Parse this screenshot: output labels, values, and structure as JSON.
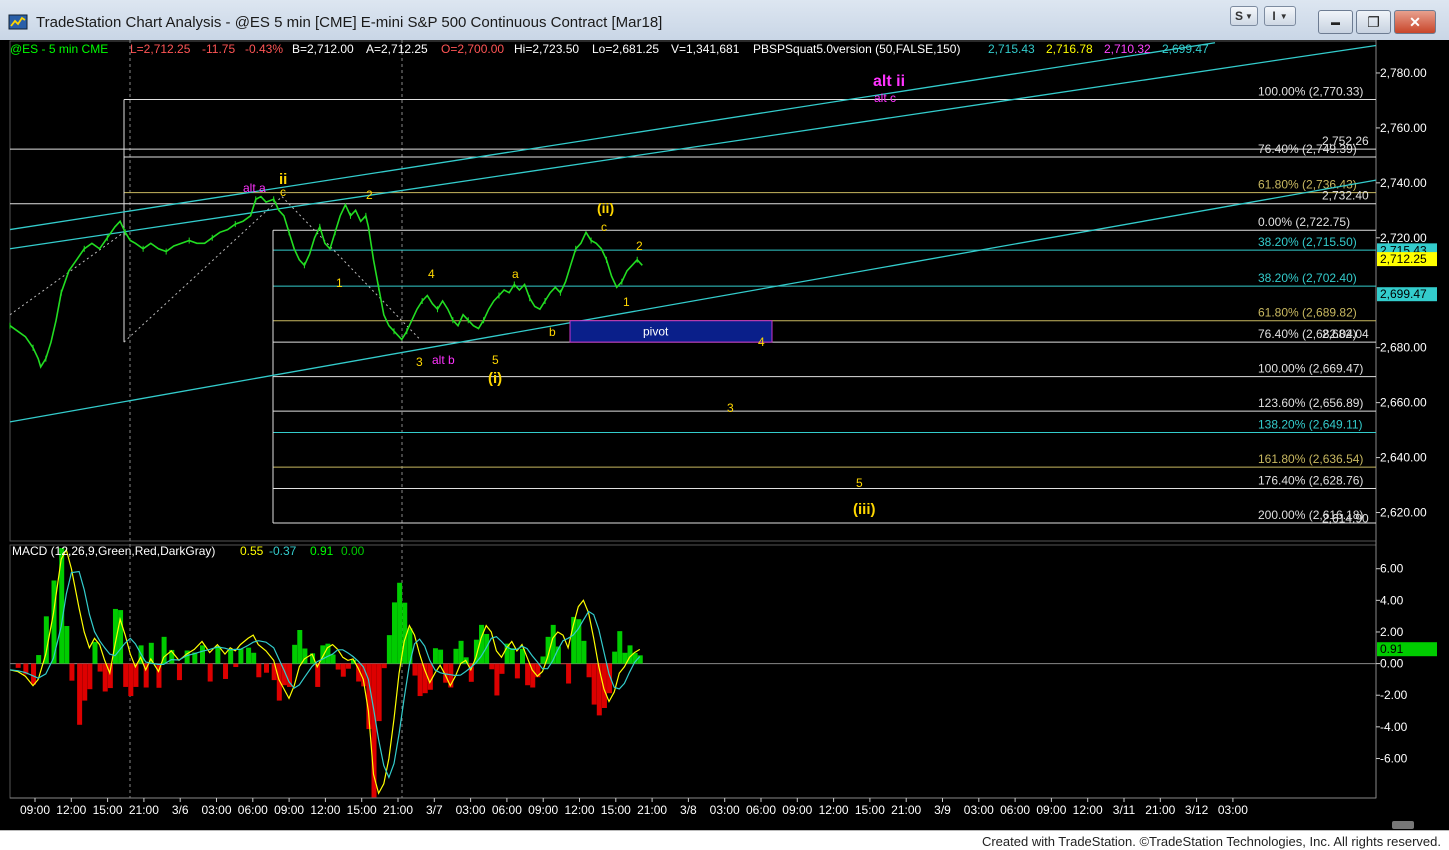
{
  "window": {
    "title": "TradeStation Chart Analysis - @ES 5 min [CME] E-mini S&P 500 Continuous Contract [Mar18]",
    "s_button": "S",
    "i_button": "I",
    "minimize": "▬",
    "maximize": "❐",
    "close": "✕"
  },
  "footer": {
    "text": "Created with TradeStation. ©TradeStation Technologies, Inc. All rights reserved."
  },
  "colors": {
    "price": "#22dd22",
    "cyan": "#33cccc",
    "yellow": "#ffd700",
    "magenta": "#ff33ff",
    "macd_up": "#00cc00",
    "macd_down": "#dd0000"
  },
  "chart_data": {
    "type": "line",
    "symbol": "@ES",
    "interval": "5 min",
    "exchange": "CME",
    "ylim": [
      2610,
      2792
    ],
    "status_bar": {
      "symbol_label": "@ES - 5 min  CME",
      "last": "L=2,712.25",
      "change": "-11.75",
      "change_pct": "-0.43%",
      "bid": "B=2,712.00",
      "ask": "A=2,712.25",
      "open": "O=2,700.00",
      "high": "Hi=2,723.50",
      "low": "Lo=2,681.25",
      "volume": "V=1,341,681",
      "indicator": "PBSPSquat5.0version (50,FALSE,150)",
      "ind_values": [
        "2,715.43",
        "2,716.78",
        "2,710.32",
        "2,699.47"
      ]
    },
    "y_ticks": [
      {
        "v": 2780,
        "label": "2,780.00"
      },
      {
        "v": 2760,
        "label": "2,760.00"
      },
      {
        "v": 2740,
        "label": "2,740.00"
      },
      {
        "v": 2720,
        "label": "2,720.00"
      },
      {
        "v": 2680,
        "label": "2,680.00"
      },
      {
        "v": 2660,
        "label": "2,660.00"
      },
      {
        "v": 2640,
        "label": "2,640.00"
      },
      {
        "v": 2620,
        "label": "2,620.00"
      }
    ],
    "price_tags": [
      {
        "v": 2715.43,
        "label": "2,715.43",
        "color": "#33cccc"
      },
      {
        "v": 2712.25,
        "label": "2,712.25",
        "color": "#ffff00"
      },
      {
        "v": 2699.47,
        "label": "2,699.47",
        "color": "#33cccc"
      }
    ],
    "x_ticks": [
      "09:00",
      "12:00",
      "15:00",
      "21:00",
      "3/6",
      "03:00",
      "06:00",
      "09:00",
      "12:00",
      "15:00",
      "21:00",
      "3/7",
      "03:00",
      "06:00",
      "09:00",
      "12:00",
      "15:00",
      "21:00",
      "3/8",
      "03:00",
      "06:00",
      "09:00",
      "12:00",
      "15:00",
      "21:00",
      "3/9",
      "03:00",
      "06:00",
      "09:00",
      "12:00",
      "3/11",
      "21:00",
      "3/12",
      "03:00"
    ],
    "fib_levels": [
      {
        "pct": "100.00%",
        "price": "(2,770.33)",
        "v": 2770.33,
        "color": "#e0e0e0"
      },
      {
        "pct": "76.40%",
        "price": "(2,749.39)",
        "v": 2749.39,
        "color": "#e0e0e0"
      },
      {
        "pct": "61.80%",
        "price": "(2,736.43)",
        "v": 2736.43,
        "color": "#c8b860"
      },
      {
        "pct": "0.00%",
        "price": "(2,722.75)",
        "v": 2722.75,
        "color": "#e0e0e0"
      },
      {
        "pct": "38.20%",
        "price": "(2,715.50)",
        "v": 2715.5,
        "color": "#33cccc"
      },
      {
        "pct": "38.20%",
        "price": "(2,702.40)",
        "v": 2702.4,
        "color": "#33cccc"
      },
      {
        "pct": "61.80%",
        "price": "(2,689.82)",
        "v": 2689.82,
        "color": "#c8b860"
      },
      {
        "pct": "76.40%",
        "price": "(2,682.04)",
        "v": 2682.04,
        "color": "#e0e0e0"
      },
      {
        "pct": "100.00%",
        "price": "(2,669.47)",
        "v": 2669.47,
        "color": "#e0e0e0"
      },
      {
        "pct": "123.60%",
        "price": "(2,656.89)",
        "v": 2656.89,
        "color": "#e0e0e0"
      },
      {
        "pct": "138.20%",
        "price": "(2,649.11)",
        "v": 2649.11,
        "color": "#33cccc"
      },
      {
        "pct": "161.80%",
        "price": "(2,636.54)",
        "v": 2636.54,
        "color": "#c8b860"
      },
      {
        "pct": "176.40%",
        "price": "(2,628.76)",
        "v": 2628.76,
        "color": "#e0e0e0"
      },
      {
        "pct": "200.00%",
        "price": "(2,616.18)",
        "v": 2616.18,
        "color": "#e0e0e0"
      }
    ],
    "extra_price_labels": [
      {
        "label": "2,752.26",
        "v": 2752.26
      },
      {
        "label": "2,732.40",
        "v": 2732.4
      },
      {
        "label": "2,682.04",
        "v": 2682.04
      },
      {
        "label": "2,614.90",
        "v": 2614.9
      }
    ],
    "pivot_label": "pivot",
    "pivot_range": [
      2682.04,
      2689.82
    ],
    "wave_labels": [
      {
        "text": "alt ii",
        "color": "#ff33ff",
        "bold": true
      },
      {
        "text": "alt c",
        "color": "#ff33ff",
        "bold": false
      },
      {
        "text": "alt a",
        "color": "#ff33ff",
        "bold": false
      },
      {
        "text": "ii",
        "color": "#ffd700",
        "bold": true
      },
      {
        "text": "c",
        "color": "#ffd700",
        "bold": false
      },
      {
        "text": "2",
        "color": "#ffd700",
        "bold": false
      },
      {
        "text": "1",
        "color": "#ffd700",
        "bold": false
      },
      {
        "text": "4",
        "color": "#ffd700",
        "bold": false
      },
      {
        "text": "3",
        "color": "#ffd700",
        "bold": false
      },
      {
        "text": "alt b",
        "color": "#ff33ff",
        "bold": false
      },
      {
        "text": "5",
        "color": "#ffd700",
        "bold": false
      },
      {
        "text": "(i)",
        "color": "#ffd700",
        "bold": true
      },
      {
        "text": "a",
        "color": "#ffd700",
        "bold": false
      },
      {
        "text": "b",
        "color": "#ffd700",
        "bold": false
      },
      {
        "text": "(ii)",
        "color": "#ffd700",
        "bold": true
      },
      {
        "text": "c",
        "color": "#ffd700",
        "bold": false
      },
      {
        "text": "2",
        "color": "#ffd700",
        "bold": false
      },
      {
        "text": "1",
        "color": "#ffd700",
        "bold": false
      },
      {
        "text": "4",
        "color": "#ffd700",
        "bold": false
      },
      {
        "text": "3",
        "color": "#ffd700",
        "bold": false
      },
      {
        "text": "5",
        "color": "#ffd700",
        "bold": false
      },
      {
        "text": "(iii)",
        "color": "#ffd700",
        "bold": true
      }
    ],
    "price_series": [
      [
        0,
        2688
      ],
      [
        6,
        2686
      ],
      [
        12,
        2684
      ],
      [
        18,
        2680
      ],
      [
        22,
        2676
      ],
      [
        24,
        2673
      ],
      [
        28,
        2676
      ],
      [
        32,
        2682
      ],
      [
        36,
        2690
      ],
      [
        40,
        2700
      ],
      [
        46,
        2708
      ],
      [
        52,
        2712
      ],
      [
        58,
        2716
      ],
      [
        64,
        2718
      ],
      [
        70,
        2716
      ],
      [
        76,
        2720
      ],
      [
        82,
        2724
      ],
      [
        86,
        2726
      ],
      [
        90,
        2722
      ],
      [
        94,
        2719
      ],
      [
        98,
        2718
      ],
      [
        104,
        2716
      ],
      [
        110,
        2718
      ],
      [
        116,
        2716
      ],
      [
        122,
        2715
      ],
      [
        128,
        2717
      ],
      [
        134,
        2718
      ],
      [
        140,
        2719
      ],
      [
        146,
        2718
      ],
      [
        152,
        2718
      ],
      [
        158,
        2720
      ],
      [
        164,
        2722
      ],
      [
        170,
        2723
      ],
      [
        176,
        2725
      ],
      [
        182,
        2726
      ],
      [
        188,
        2728
      ],
      [
        192,
        2734
      ],
      [
        196,
        2735
      ],
      [
        200,
        2733
      ],
      [
        206,
        2734
      ],
      [
        210,
        2730
      ],
      [
        214,
        2728
      ],
      [
        218,
        2722
      ],
      [
        222,
        2716
      ],
      [
        226,
        2712
      ],
      [
        230,
        2710
      ],
      [
        234,
        2714
      ],
      [
        238,
        2720
      ],
      [
        242,
        2724
      ],
      [
        246,
        2718
      ],
      [
        250,
        2716
      ],
      [
        254,
        2722
      ],
      [
        258,
        2728
      ],
      [
        262,
        2732
      ],
      [
        266,
        2728
      ],
      [
        270,
        2730
      ],
      [
        274,
        2726
      ],
      [
        278,
        2728
      ],
      [
        280,
        2724
      ],
      [
        284,
        2712
      ],
      [
        288,
        2702
      ],
      [
        292,
        2692
      ],
      [
        296,
        2688
      ],
      [
        300,
        2686
      ],
      [
        304,
        2684
      ],
      [
        306,
        2683
      ],
      [
        310,
        2686
      ],
      [
        314,
        2690
      ],
      [
        318,
        2694
      ],
      [
        322,
        2697
      ],
      [
        326,
        2699
      ],
      [
        330,
        2696
      ],
      [
        334,
        2694
      ],
      [
        338,
        2697
      ],
      [
        342,
        2694
      ],
      [
        346,
        2690
      ],
      [
        350,
        2688
      ],
      [
        354,
        2692
      ],
      [
        358,
        2690
      ],
      [
        362,
        2688
      ],
      [
        366,
        2687
      ],
      [
        370,
        2690
      ],
      [
        374,
        2694
      ],
      [
        378,
        2697
      ],
      [
        382,
        2699
      ],
      [
        386,
        2701
      ],
      [
        390,
        2700
      ],
      [
        394,
        2703
      ],
      [
        398,
        2701
      ],
      [
        402,
        2703
      ],
      [
        406,
        2698
      ],
      [
        410,
        2695
      ],
      [
        414,
        2694
      ],
      [
        418,
        2697
      ],
      [
        422,
        2700
      ],
      [
        426,
        2702
      ],
      [
        430,
        2700
      ],
      [
        434,
        2704
      ],
      [
        438,
        2710
      ],
      [
        442,
        2716
      ],
      [
        446,
        2718
      ],
      [
        450,
        2722
      ],
      [
        454,
        2719
      ],
      [
        458,
        2718
      ],
      [
        462,
        2716
      ],
      [
        466,
        2712
      ],
      [
        470,
        2706
      ],
      [
        474,
        2702
      ],
      [
        478,
        2704
      ],
      [
        482,
        2708
      ],
      [
        486,
        2710
      ],
      [
        490,
        2712
      ],
      [
        494,
        2710
      ]
    ],
    "macd": {
      "label": "MACD (12,26,9,Green,Red,DarkGray)",
      "values": [
        "0.55",
        "-0.37",
        "0.91",
        "0.00"
      ],
      "value_colors": [
        "#ffff00",
        "#33cccc",
        "#00ff00",
        "#00cc00"
      ],
      "ylim": [
        -8.5,
        7.5
      ],
      "y_ticks": [
        {
          "v": 6,
          "label": "6.00"
        },
        {
          "v": 4,
          "label": "4.00"
        },
        {
          "v": 2,
          "label": "2.00"
        },
        {
          "v": 0,
          "label": "0.00"
        },
        {
          "v": -2,
          "label": "-2.00"
        },
        {
          "v": -4,
          "label": "-4.00"
        },
        {
          "v": -6,
          "label": "-6.00"
        }
      ],
      "last_tag": "0.91",
      "series": [
        [
          0,
          -0.4
        ],
        [
          6,
          -0.5
        ],
        [
          12,
          -0.8
        ],
        [
          18,
          -1.4
        ],
        [
          22,
          -1.0
        ],
        [
          28,
          0.6
        ],
        [
          34,
          3.2
        ],
        [
          40,
          6.6
        ],
        [
          44,
          7.2
        ],
        [
          48,
          6.0
        ],
        [
          54,
          3.5
        ],
        [
          58,
          2.0
        ],
        [
          62,
          1.0
        ],
        [
          66,
          1.6
        ],
        [
          70,
          1.2
        ],
        [
          74,
          0.2
        ],
        [
          78,
          -0.6
        ],
        [
          82,
          1.2
        ],
        [
          86,
          2.8
        ],
        [
          90,
          1.8
        ],
        [
          94,
          0.6
        ],
        [
          98,
          -0.2
        ],
        [
          102,
          0.4
        ],
        [
          106,
          -0.4
        ],
        [
          110,
          0.3
        ],
        [
          116,
          -0.5
        ],
        [
          120,
          0.4
        ],
        [
          126,
          0.8
        ],
        [
          132,
          0.2
        ],
        [
          138,
          0.6
        ],
        [
          144,
          0.9
        ],
        [
          150,
          1.4
        ],
        [
          156,
          0.7
        ],
        [
          162,
          1.2
        ],
        [
          168,
          0.6
        ],
        [
          172,
          1.0
        ],
        [
          176,
          0.8
        ],
        [
          180,
          1.2
        ],
        [
          186,
          1.6
        ],
        [
          190,
          1.8
        ],
        [
          194,
          1.2
        ],
        [
          200,
          0.8
        ],
        [
          206,
          0.2
        ],
        [
          210,
          -1.0
        ],
        [
          214,
          -1.6
        ],
        [
          218,
          -2.2
        ],
        [
          222,
          -1.4
        ],
        [
          226,
          -0.2
        ],
        [
          230,
          0.3
        ],
        [
          236,
          0.6
        ],
        [
          240,
          -0.2
        ],
        [
          244,
          0.4
        ],
        [
          248,
          1.0
        ],
        [
          252,
          1.2
        ],
        [
          256,
          0.9
        ],
        [
          260,
          0.4
        ],
        [
          264,
          0.2
        ],
        [
          268,
          0.3
        ],
        [
          272,
          -0.3
        ],
        [
          276,
          -1.0
        ],
        [
          280,
          -3.0
        ],
        [
          284,
          -7.0
        ],
        [
          288,
          -8.2
        ],
        [
          292,
          -7.6
        ],
        [
          296,
          -6.0
        ],
        [
          300,
          -3.5
        ],
        [
          304,
          -0.6
        ],
        [
          308,
          1.4
        ],
        [
          312,
          2.4
        ],
        [
          316,
          1.8
        ],
        [
          320,
          0.6
        ],
        [
          324,
          -0.4
        ],
        [
          328,
          -1.2
        ],
        [
          332,
          -0.6
        ],
        [
          336,
          -0.1
        ],
        [
          340,
          -0.7
        ],
        [
          344,
          -1.4
        ],
        [
          348,
          -0.8
        ],
        [
          352,
          0.0
        ],
        [
          356,
          0.2
        ],
        [
          360,
          -0.4
        ],
        [
          364,
          0.4
        ],
        [
          368,
          1.6
        ],
        [
          372,
          2.4
        ],
        [
          376,
          2.0
        ],
        [
          380,
          0.8
        ],
        [
          384,
          0.4
        ],
        [
          388,
          1.0
        ],
        [
          392,
          1.4
        ],
        [
          396,
          0.8
        ],
        [
          400,
          1.2
        ],
        [
          404,
          0.4
        ],
        [
          408,
          -0.4
        ],
        [
          412,
          -0.8
        ],
        [
          416,
          -0.5
        ],
        [
          420,
          0.4
        ],
        [
          424,
          1.6
        ],
        [
          428,
          2.0
        ],
        [
          432,
          1.8
        ],
        [
          436,
          1.0
        ],
        [
          440,
          2.4
        ],
        [
          444,
          3.6
        ],
        [
          448,
          4.0
        ],
        [
          452,
          3.2
        ],
        [
          456,
          1.6
        ],
        [
          460,
          -0.2
        ],
        [
          464,
          -1.6
        ],
        [
          468,
          -2.4
        ],
        [
          472,
          -1.8
        ],
        [
          476,
          -0.6
        ],
        [
          480,
          -0.2
        ],
        [
          484,
          0.4
        ],
        [
          488,
          0.7
        ],
        [
          492,
          0.9
        ]
      ]
    }
  }
}
